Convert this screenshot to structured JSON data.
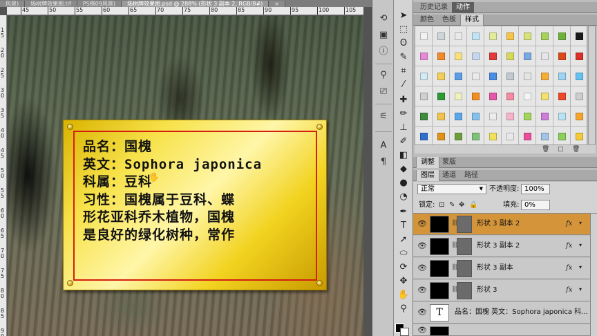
{
  "doc_tabs": [
    "风景)",
    "场树牌效果图.tif",
    "PS例09风景)",
    "场树牌效果图.psd @ 288% (形状 3 副本 2, RGB/8#)",
    "×"
  ],
  "ruler": {
    "top_labels": [
      "45",
      "50",
      "55",
      "60",
      "65",
      "70",
      "75",
      "80",
      "85",
      "90",
      "95",
      "100",
      "105"
    ],
    "left_labels": [
      "1 5",
      "2 0",
      "2 5",
      "3 0",
      "3 5",
      "4 0",
      "4 5",
      "5 0",
      "5 5",
      "6 0",
      "6 5",
      "7 0",
      "7 5",
      "8 0",
      "8 5",
      "9 0"
    ]
  },
  "plaque": {
    "lines": [
      "品名：国槐",
      "英文：Sophora japonica",
      "科属：豆科",
      "习性：国槐属于豆科、蝶",
      "形花亚科乔木植物，国槐",
      "是良好的绿化树种，常作"
    ]
  },
  "panel_tabs_top": {
    "history": "历史记录",
    "actions": "动作"
  },
  "panel_tabs_styles": {
    "color": "颜色",
    "swatches": "色板",
    "styles": "样式"
  },
  "panel_tabs_adjust": {
    "adjust": "调整",
    "mask": "蒙版"
  },
  "panel_tabs_layers": {
    "layers": "图层",
    "channels": "通道",
    "paths": "路径"
  },
  "layers": {
    "blend_mode": "正常",
    "opacity_label": "不透明度:",
    "opacity": "100%",
    "lock_label": "锁定:",
    "fill_label": "填充:",
    "fill": "0%",
    "items": [
      {
        "name": "形状 3 副本 2",
        "fx": "fx",
        "selected": true
      },
      {
        "name": "形状 3 副本 2",
        "fx": "fx",
        "selected": false
      },
      {
        "name": "形状 3 副本",
        "fx": "fx",
        "selected": false
      },
      {
        "name": "形状 3",
        "fx": "fx",
        "selected": false
      },
      {
        "name": "品名：国槐 英文：Sophora japonica 科...",
        "fx": "",
        "selected": false,
        "thumb": "T"
      }
    ]
  },
  "style_colors": [
    "#f2f2f2",
    "#cfd6da",
    "#e9e9e9",
    "#bfe4f5",
    "#e3ec9a",
    "#f6c44a",
    "#d6e27a",
    "#a6d25a",
    "#6fb23a",
    "#1b1b1b",
    "#e58ad8",
    "#f08a2a",
    "#f6e17c",
    "#c7d7f2",
    "#e23939",
    "#d7d85a",
    "#79a9e0",
    "#e6e6ea",
    "#dd4a1a",
    "#d9302a",
    "#d2e9f6",
    "#f3cf57",
    "#5b9de8",
    "#eaeaea",
    "#4a8ee6",
    "#c1c9d0",
    "#e4e4e4",
    "#f6ad34",
    "#9dd4f1",
    "#64c2ef",
    "#cfcfcf",
    "#2e9a35",
    "#eff1bf",
    "#f48d20",
    "#e55aa8",
    "#f58aa0",
    "#f4f4f4",
    "#f2e06f",
    "#ec4a28",
    "#cdcdcd",
    "#3f8d3c",
    "#f2c34a",
    "#5aa7ea",
    "#83c1ee",
    "#ececec",
    "#f6b4cc",
    "#a2d65a",
    "#cf7ddb",
    "#b9e3f2",
    "#f5a52e",
    "#2f6fcf",
    "#e09216",
    "#6e9e3a",
    "#7ec27a",
    "#f4e15a",
    "#e8e8e8",
    "#ea4f9b",
    "#a1c4e6",
    "#8ccf5b",
    "#f4c93a"
  ],
  "styles_footer": {
    "trash": "🗑",
    "new": "□",
    "delete": "🗑"
  },
  "canvas_cursor": "🖐"
}
